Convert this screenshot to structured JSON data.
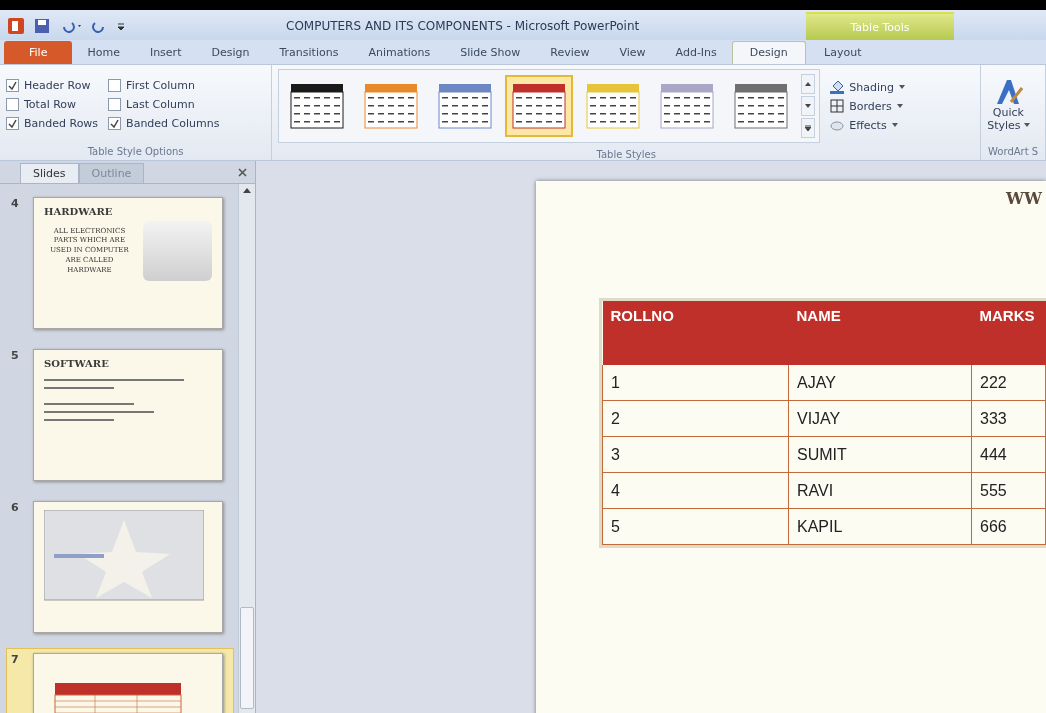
{
  "window": {
    "title": "COMPUTERS AND ITS COMPONENTS - Microsoft PowerPoint"
  },
  "contextual_group": {
    "label": "Table Tools"
  },
  "tabs": [
    {
      "label": "File",
      "kind": "file",
      "selected": false
    },
    {
      "label": "Home",
      "kind": "tab",
      "selected": false
    },
    {
      "label": "Insert",
      "kind": "tab",
      "selected": false
    },
    {
      "label": "Design",
      "kind": "tab",
      "selected": false
    },
    {
      "label": "Transitions",
      "kind": "tab",
      "selected": false
    },
    {
      "label": "Animations",
      "kind": "tab",
      "selected": false
    },
    {
      "label": "Slide Show",
      "kind": "tab",
      "selected": false
    },
    {
      "label": "Review",
      "kind": "tab",
      "selected": false
    },
    {
      "label": "View",
      "kind": "tab",
      "selected": false
    },
    {
      "label": "Add-Ins",
      "kind": "tab",
      "selected": false
    },
    {
      "label": "Design",
      "kind": "contextual",
      "selected": true
    },
    {
      "label": "Layout",
      "kind": "contextual",
      "selected": false
    }
  ],
  "ribbon": {
    "table_style_options": {
      "label": "Table Style Options",
      "options": [
        {
          "label": "Header Row",
          "checked": true
        },
        {
          "label": "First Column",
          "checked": false
        },
        {
          "label": "Total Row",
          "checked": false
        },
        {
          "label": "Last Column",
          "checked": false
        },
        {
          "label": "Banded Rows",
          "checked": true
        },
        {
          "label": "Banded Columns",
          "checked": true
        }
      ]
    },
    "table_styles": {
      "label": "Table Styles",
      "styles": [
        {
          "color": "#1a1a1a",
          "selected": false
        },
        {
          "color": "#e8892c",
          "selected": false
        },
        {
          "color": "#6d87c5",
          "selected": false
        },
        {
          "color": "#c0302a",
          "selected": true
        },
        {
          "color": "#e6c53a",
          "selected": false
        },
        {
          "color": "#a9a6c6",
          "selected": false
        },
        {
          "color": "#6f6f6f",
          "selected": false
        }
      ],
      "commands": [
        {
          "label": "Shading",
          "kind": "shading"
        },
        {
          "label": "Borders",
          "kind": "borders"
        },
        {
          "label": "Effects",
          "kind": "effects"
        }
      ]
    },
    "wordart": {
      "label": "WordArt S",
      "quick_styles": [
        "Quick",
        "Styles"
      ]
    }
  },
  "pane": {
    "tabs": [
      {
        "label": "Slides",
        "selected": true
      },
      {
        "label": "Outline",
        "selected": false
      }
    ],
    "slides": [
      {
        "number": "4",
        "kind": "hardware",
        "selected": false,
        "title": "HARDWARE",
        "text": "ALL ELECTRONICS PARTS WHICH ARE USED IN COMPUTER ARE CALLED HARDWARE"
      },
      {
        "number": "5",
        "kind": "text",
        "selected": false,
        "title": "SOFTWARE"
      },
      {
        "number": "6",
        "kind": "picture",
        "selected": false
      },
      {
        "number": "7",
        "kind": "table",
        "selected": true
      }
    ]
  },
  "slide": {
    "corner_text": "WW",
    "table": {
      "columns": [
        "ROLLNO",
        "NAME",
        "MARKS"
      ],
      "rows": [
        [
          "1",
          "AJAY",
          "222"
        ],
        [
          "2",
          "VIJAY",
          "333"
        ],
        [
          "3",
          "SUMIT",
          "444"
        ],
        [
          "4",
          "RAVI",
          "555"
        ],
        [
          "5",
          "KAPIL",
          "666"
        ]
      ]
    }
  }
}
